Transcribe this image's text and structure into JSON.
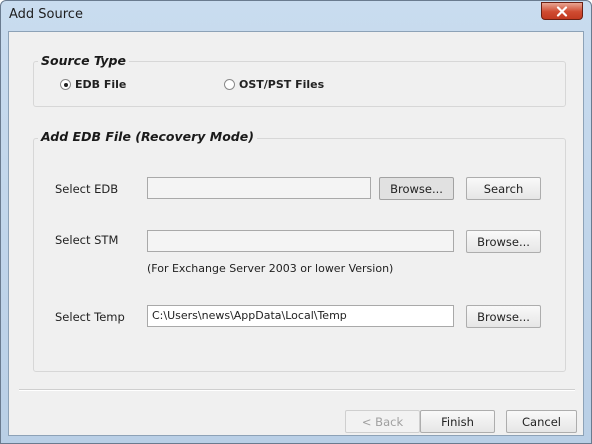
{
  "window": {
    "title": "Add Source",
    "close_icon": "close-icon"
  },
  "source_type": {
    "title": "Source Type",
    "options": [
      {
        "label": "EDB File",
        "selected": true
      },
      {
        "label": "OST/PST Files",
        "selected": false
      }
    ]
  },
  "add_edb": {
    "title": "Add EDB File (Recovery Mode)",
    "select_edb": {
      "label": "Select EDB",
      "value": "",
      "browse_label": "Browse...",
      "search_label": "Search"
    },
    "select_stm": {
      "label": "Select STM",
      "value": "",
      "browse_label": "Browse...",
      "note": "(For Exchange Server 2003 or lower Version)"
    },
    "select_temp": {
      "label": "Select Temp",
      "value": "C:\\Users\\news\\AppData\\Local\\Temp",
      "browse_label": "Browse..."
    }
  },
  "footer": {
    "back_label": "< Back",
    "finish_label": "Finish",
    "cancel_label": "Cancel"
  }
}
